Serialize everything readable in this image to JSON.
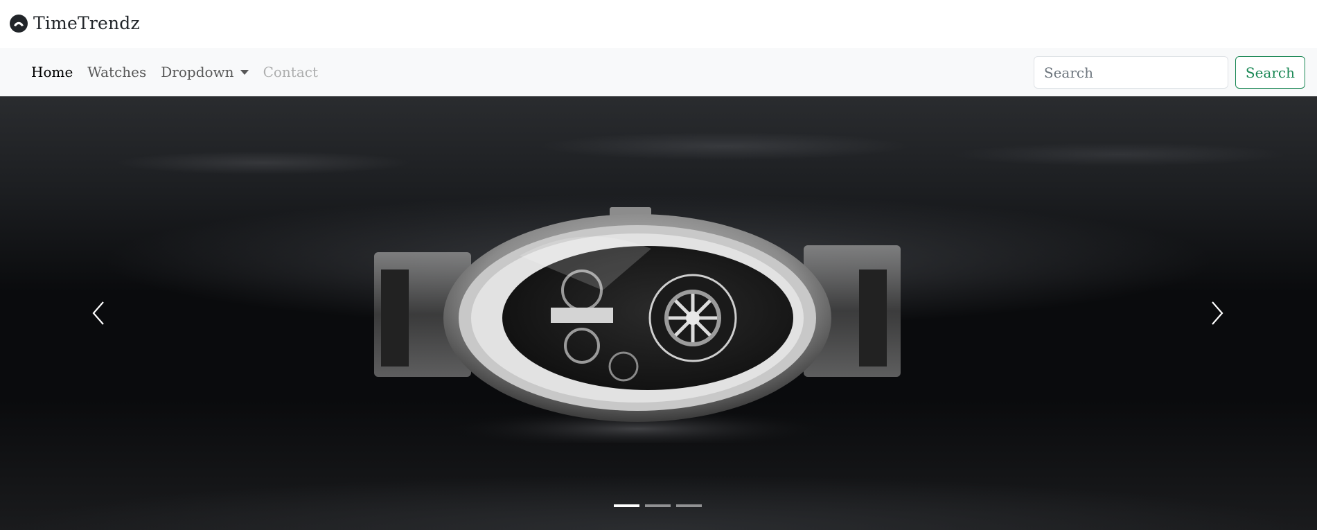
{
  "brand": {
    "name": "TimeTrendz",
    "icon": "brand-logo-icon"
  },
  "nav": {
    "links": [
      {
        "label": "Home",
        "state": "active"
      },
      {
        "label": "Watches",
        "state": "normal"
      },
      {
        "label": "Dropdown",
        "state": "dropdown"
      },
      {
        "label": "Contact",
        "state": "disabled"
      }
    ]
  },
  "search": {
    "placeholder": "Search",
    "value": "",
    "button_label": "Search"
  },
  "carousel": {
    "slide_image": "skeleton-watch-photo",
    "active_index": 0,
    "slide_count": 3,
    "prev_icon": "chevron-left-icon",
    "next_icon": "chevron-right-icon"
  },
  "colors": {
    "navbar_bg": "#f8f9fa",
    "search_button": "#198754",
    "text_dark": "#212529"
  }
}
